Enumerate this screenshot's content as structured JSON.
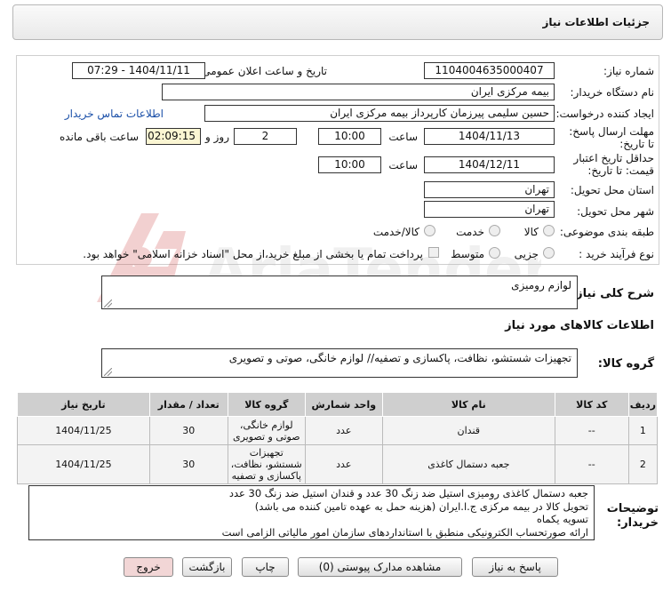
{
  "header": {
    "title": "جزئیات اطلاعات نیاز"
  },
  "form": {
    "need_number_label": "شماره نیاز:",
    "need_number": "1104004635000407",
    "announce_label": "تاریخ و ساعت اعلان عمومی:",
    "announce_value": "1404/11/11 - 07:29",
    "buyer_org_label": "نام دستگاه خریدار:",
    "buyer_org": "بیمه مرکزی ایران",
    "creator_label": "ایجاد کننده درخواست:",
    "creator": "حسین سلیمی پیرزمان کارپرداز بیمه مرکزی ایران",
    "contact_link": "اطلاعات تماس خریدار",
    "deadline_label": "مهلت ارسال پاسخ: تا تاریخ:",
    "deadline_date": "1404/11/13",
    "time_label": "ساعت",
    "deadline_time": "10:00",
    "days": "2",
    "days_label": "روز و",
    "remaining": "02:09:15",
    "remaining_label": "ساعت باقی مانده",
    "validity_label": "حداقل تاریخ اعتبار قیمت: تا تاریخ:",
    "validity_date": "1404/12/11",
    "validity_time": "10:00",
    "province_label": "استان محل تحویل:",
    "province": "تهران",
    "city_label": "شهر محل تحویل:",
    "city": "تهران",
    "category_label": "طبقه بندی موضوعی:",
    "category_options": [
      "کالا",
      "خدمت",
      "کالا/خدمت"
    ],
    "process_label": "نوع فرآیند خرید :",
    "process_options": [
      "جزیی",
      "متوسط"
    ],
    "payment_note": "پرداخت تمام یا بخشی از مبلغ خرید،از محل \"اسناد خزانه اسلامی\" خواهد بود."
  },
  "description": {
    "label": "شرح کلی نیاز:",
    "value": "لوازم رومیزی"
  },
  "goods": {
    "section_title": "اطلاعات کالاهای مورد نیاز",
    "group_label": "گروه کالا:",
    "group_value": "تجهیزات شستشو، نظافت، پاکسازی و تصفیه// لوازم خانگی، صوتی و تصویری",
    "columns": [
      "ردیف",
      "کد کالا",
      "نام کالا",
      "واحد شمارش",
      "گروه کالا",
      "تعداد / مقدار",
      "تاریخ نیاز"
    ],
    "rows": [
      {
        "idx": "1",
        "code": "--",
        "name": "قندان",
        "unit": "عدد",
        "group": "لوازم خانگی، صوتی و تصویری",
        "qty": "30",
        "date": "1404/11/25"
      },
      {
        "idx": "2",
        "code": "--",
        "name": "جعبه دستمال کاغذی",
        "unit": "عدد",
        "group": "تجهیزات شستشو، نظافت، پاکسازی و تصفیه",
        "qty": "30",
        "date": "1404/11/25"
      }
    ]
  },
  "buyer_notes": {
    "label": "توضیحات خریدار:",
    "lines": [
      "جعبه دستمال کاغذی رومیزی استیل ضد زنگ 30 عدد  و  قندان استیل ضد زنگ 30 عدد",
      "تحویل کالا در  بیمه مرکزی ج.ا.ایران  (هزینه حمل به عهده تامین کننده می باشد)",
      "تسویه  یکماه",
      "ارائه صورتحساب الکترونیکی منطبق با استانداردهای سازمان امور مالیاتی الزامی است"
    ]
  },
  "buttons": {
    "reply": "پاسخ به نیاز",
    "attachments": "مشاهده مدارک پیوستی (0)",
    "print": "چاپ",
    "back": "بازگشت",
    "exit": "خروج"
  },
  "watermark_text": "AriaTender.neT",
  "colors": {
    "exit_button_bg": "#f2d6d6",
    "remaining_bg": "#fbf6d3",
    "link": "#1a4fa8"
  }
}
